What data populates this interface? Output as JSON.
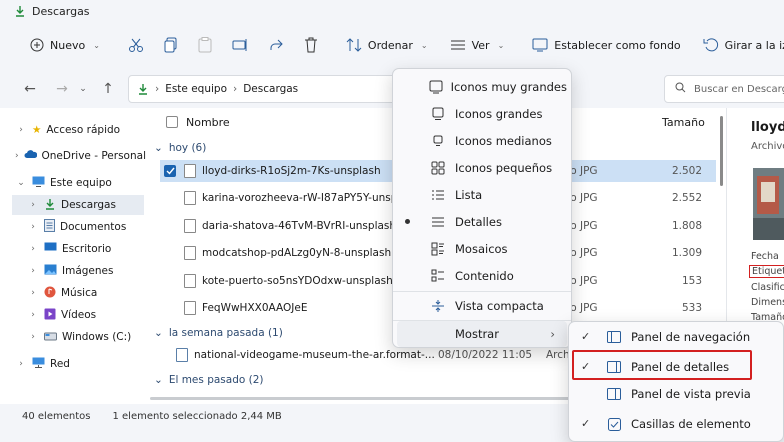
{
  "window": {
    "title": "Descargas"
  },
  "toolbar": {
    "new_label": "Nuevo",
    "sort_label": "Ordenar",
    "view_label": "Ver",
    "set_background_label": "Establecer como fondo",
    "rotate_left_label": "Girar a la izquier"
  },
  "address": {
    "crumbs": [
      "Este equipo",
      "Descargas"
    ]
  },
  "search": {
    "placeholder": "Buscar en Descarg"
  },
  "sidebar": {
    "items": [
      {
        "label": "Acceso rápido"
      },
      {
        "label": "OneDrive - Personal"
      },
      {
        "label": "Este equipo"
      },
      {
        "label": "Descargas"
      },
      {
        "label": "Documentos"
      },
      {
        "label": "Escritorio"
      },
      {
        "label": "Imágenes"
      },
      {
        "label": "Música"
      },
      {
        "label": "Vídeos"
      },
      {
        "label": "Windows (C:)"
      },
      {
        "label": "Red"
      }
    ]
  },
  "list": {
    "col_name": "Nombre",
    "col_size": "Tamaño",
    "groups": [
      {
        "label": "hoy (6)"
      },
      {
        "label": "la semana pasada (1)"
      },
      {
        "label": "El mes pasado (2)"
      }
    ],
    "rows": [
      {
        "name": "lloyd-dirks-R1oSj2m-7Ks-unsplash",
        "type": "vo JPG",
        "size": "2.502"
      },
      {
        "name": "karina-vorozheeva-rW-I87aPY5Y-unsplash",
        "type": "vo JPG",
        "size": "2.552"
      },
      {
        "name": "daria-shatova-46TvM-BVrRI-unsplash",
        "type": "vo JPG",
        "size": "1.808"
      },
      {
        "name": "modcatshop-pdALzg0yN-8-unsplash",
        "type": "vo JPG",
        "size": "1.309"
      },
      {
        "name": "kote-puerto-so5nsYDOdxw-unsplash",
        "type": "vo JPG",
        "size": "153"
      },
      {
        "name": "FeqWwHXX0AAOJeE",
        "type": "vo JPG",
        "size": "533"
      },
      {
        "name": "national-videogame-museum-the-ar.format-...",
        "date": "08/10/2022 11:05",
        "type": "Arch",
        "size": ""
      }
    ]
  },
  "preview": {
    "title": "lloyd-",
    "subtitle": "Archivo",
    "fields": [
      "Fecha",
      "Etiqueta",
      "Clasific",
      "Dimens",
      "Tamaño"
    ]
  },
  "status": {
    "count": "40 elementos",
    "selection": "1 elemento seleccionado  2,44 MB"
  },
  "view_menu": {
    "items": [
      "Iconos muy grandes",
      "Iconos grandes",
      "Iconos medianos",
      "Iconos pequeños",
      "Lista",
      "Detalles",
      "Mosaicos",
      "Contenido",
      "Vista compacta",
      "Mostrar"
    ]
  },
  "show_submenu": {
    "items": [
      "Panel de navegación",
      "Panel de detalles",
      "Panel de vista previa",
      "Casillas de elemento"
    ]
  },
  "colors": {
    "accent": "#1a63b0",
    "highlight": "#d32020",
    "selection": "#cce0f5"
  }
}
